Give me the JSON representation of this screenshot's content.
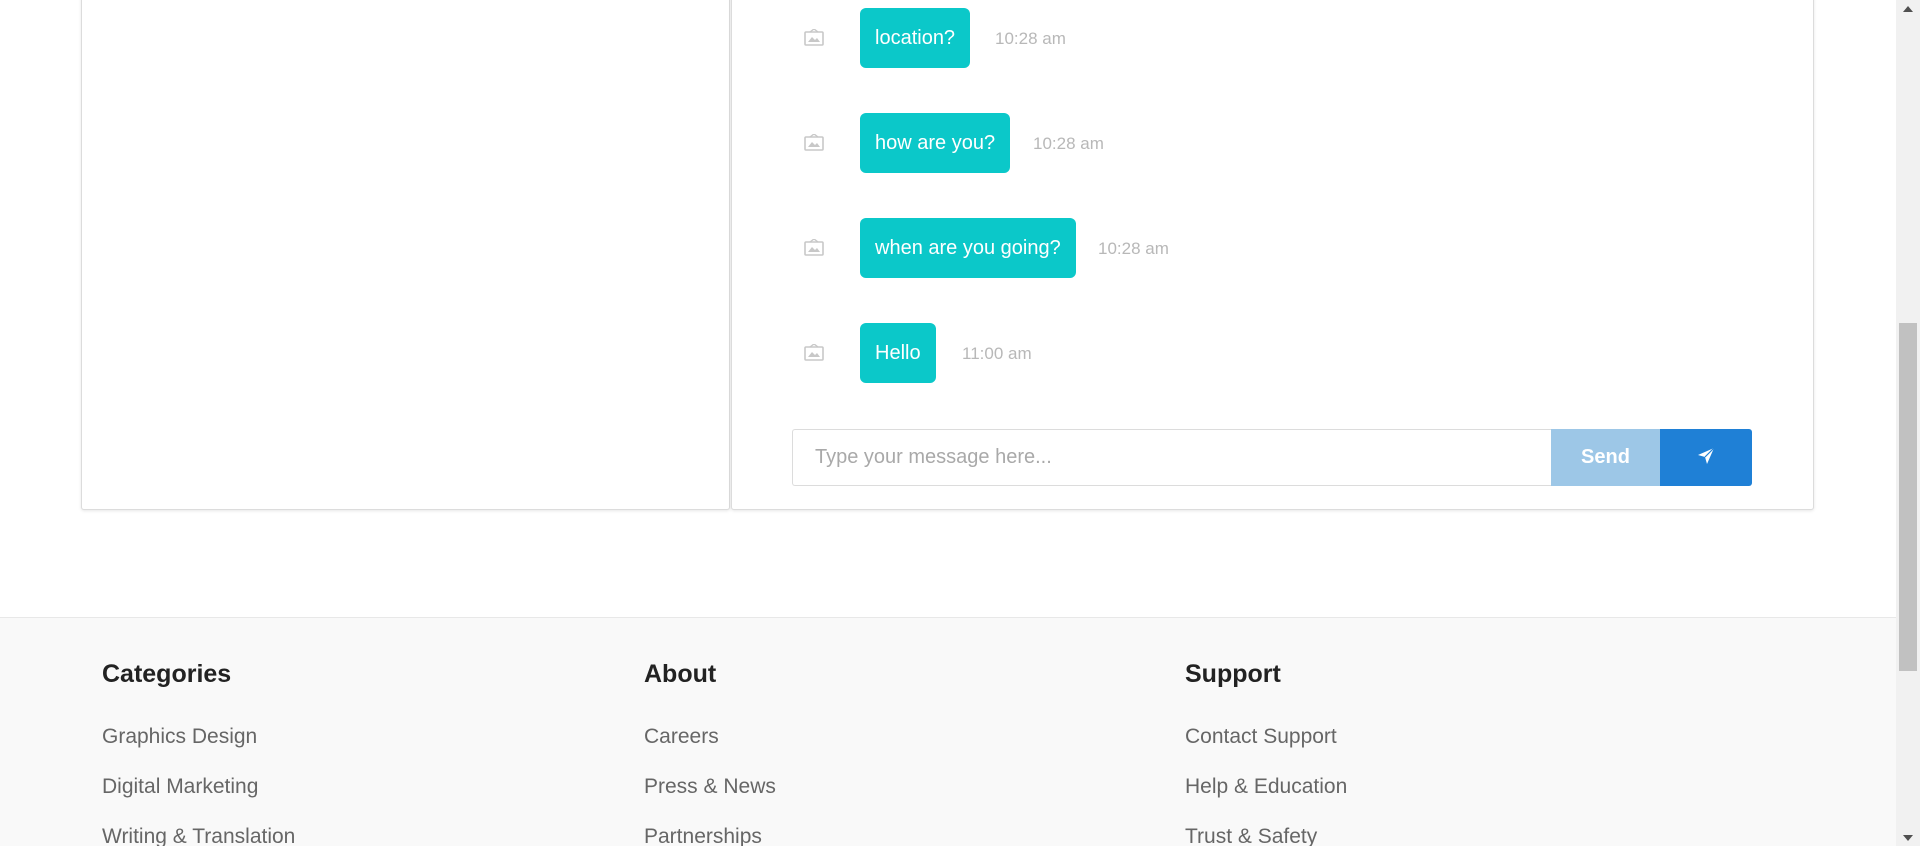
{
  "chat": {
    "messages": [
      {
        "text": "location?",
        "time": "10:28 am"
      },
      {
        "text": "how are you?",
        "time": "10:28 am"
      },
      {
        "text": "when are you going?",
        "time": "10:28 am"
      },
      {
        "text": "Hello",
        "time": "11:00 am"
      }
    ],
    "input_placeholder": "Type your message here...",
    "send_label": "Send",
    "send_icon": "paper-plane-icon",
    "avatar_icon": "broken-image-icon"
  },
  "footer": {
    "columns": [
      {
        "title": "Categories",
        "links": [
          "Graphics Design",
          "Digital Marketing",
          "Writing & Translation"
        ]
      },
      {
        "title": "About",
        "links": [
          "Careers",
          "Press & News",
          "Partnerships"
        ]
      },
      {
        "title": "Support",
        "links": [
          "Contact Support",
          "Help & Education",
          "Trust & Safety"
        ]
      }
    ]
  },
  "colors": {
    "bubble": "#0bc8c9",
    "send_button": "#9dc7e7",
    "plane_button": "#1f80d6"
  }
}
